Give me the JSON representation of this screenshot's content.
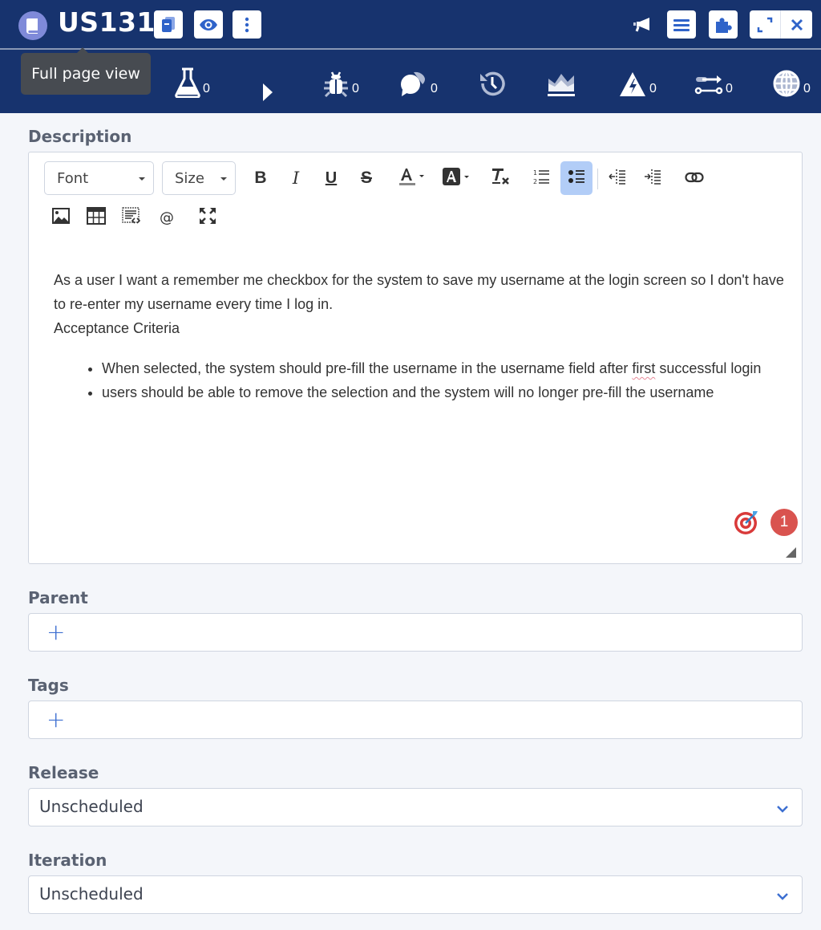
{
  "header": {
    "item_id": "US131",
    "tooltip": "Full page view",
    "left_buttons": [
      {
        "name": "copy-icon"
      },
      {
        "name": "eye-icon"
      },
      {
        "name": "more-vertical-icon"
      }
    ],
    "right_buttons": [
      {
        "name": "megaphone-icon"
      },
      {
        "name": "menu-icon"
      },
      {
        "name": "puzzle-icon"
      },
      {
        "name": "expand-icon"
      },
      {
        "name": "close-icon"
      }
    ],
    "tabs": [
      {
        "icon": "flask-icon",
        "count": "0"
      },
      {
        "icon": "play-icon",
        "count": ""
      },
      {
        "icon": "bug-icon",
        "count": "0"
      },
      {
        "icon": "comments-icon",
        "count": "0"
      },
      {
        "icon": "history-icon",
        "count": ""
      },
      {
        "icon": "area-chart-icon",
        "count": ""
      },
      {
        "icon": "warning-bolt-icon",
        "count": "0"
      },
      {
        "icon": "link-flow-icon",
        "count": "0"
      },
      {
        "icon": "globe-icon",
        "count": "0"
      }
    ]
  },
  "description": {
    "label": "Description",
    "toolbar": {
      "font": "Font",
      "size": "Size",
      "buttons": [
        "bold",
        "italic",
        "underline",
        "strikethrough",
        "text-color",
        "background-color",
        "remove-format",
        "numbered-list",
        "bulleted-list",
        "decrease-indent",
        "increase-indent",
        "link",
        "image",
        "table",
        "source",
        "mention",
        "maximize"
      ]
    },
    "paragraph": "As a user I want a remember me checkbox for the system to save my username at the login screen so I don't have to re-enter my username every time I log in.",
    "subheading": "Acceptance Criteria",
    "bullets": [
      {
        "before": "When selected, the system should pre-fill the username in the username field after ",
        "misspelled": "first",
        "after": " successful login"
      },
      {
        "before": "users should be able to remove the selection and the system will no longer pre-fill the username",
        "misspelled": "",
        "after": ""
      }
    ],
    "badge_count": "1"
  },
  "parent": {
    "label": "Parent",
    "add_symbol": "+"
  },
  "tags": {
    "label": "Tags",
    "add_symbol": "+"
  },
  "release": {
    "label": "Release",
    "value": "Unscheduled"
  },
  "iteration": {
    "label": "Iteration",
    "value": "Unscheduled"
  },
  "colors": {
    "header_bg": "#17336e",
    "accent": "#3d6fd1",
    "tooltip_bg": "#474b51",
    "badge": "#d9534f",
    "active_toolbar": "#b2cdf7"
  }
}
